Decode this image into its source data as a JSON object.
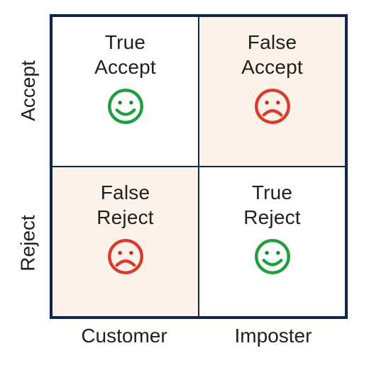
{
  "matrix": {
    "rows": [
      {
        "label": "Accept"
      },
      {
        "label": "Reject"
      }
    ],
    "cols": [
      {
        "label": "Customer"
      },
      {
        "label": "Imposter"
      }
    ],
    "cells": [
      {
        "line1": "True",
        "line2": "Accept",
        "mood": "good",
        "highlight": false
      },
      {
        "line1": "False",
        "line2": "Accept",
        "mood": "sad",
        "highlight": true
      },
      {
        "line1": "False",
        "line2": "Reject",
        "mood": "sad",
        "highlight": true
      },
      {
        "line1": "True",
        "line2": "Reject",
        "mood": "good",
        "highlight": false
      }
    ]
  },
  "colors": {
    "border": "#10254a",
    "good": "#1e9e3e",
    "bad": "#d83a2b",
    "highlight_bg": "#fdf2ea"
  }
}
